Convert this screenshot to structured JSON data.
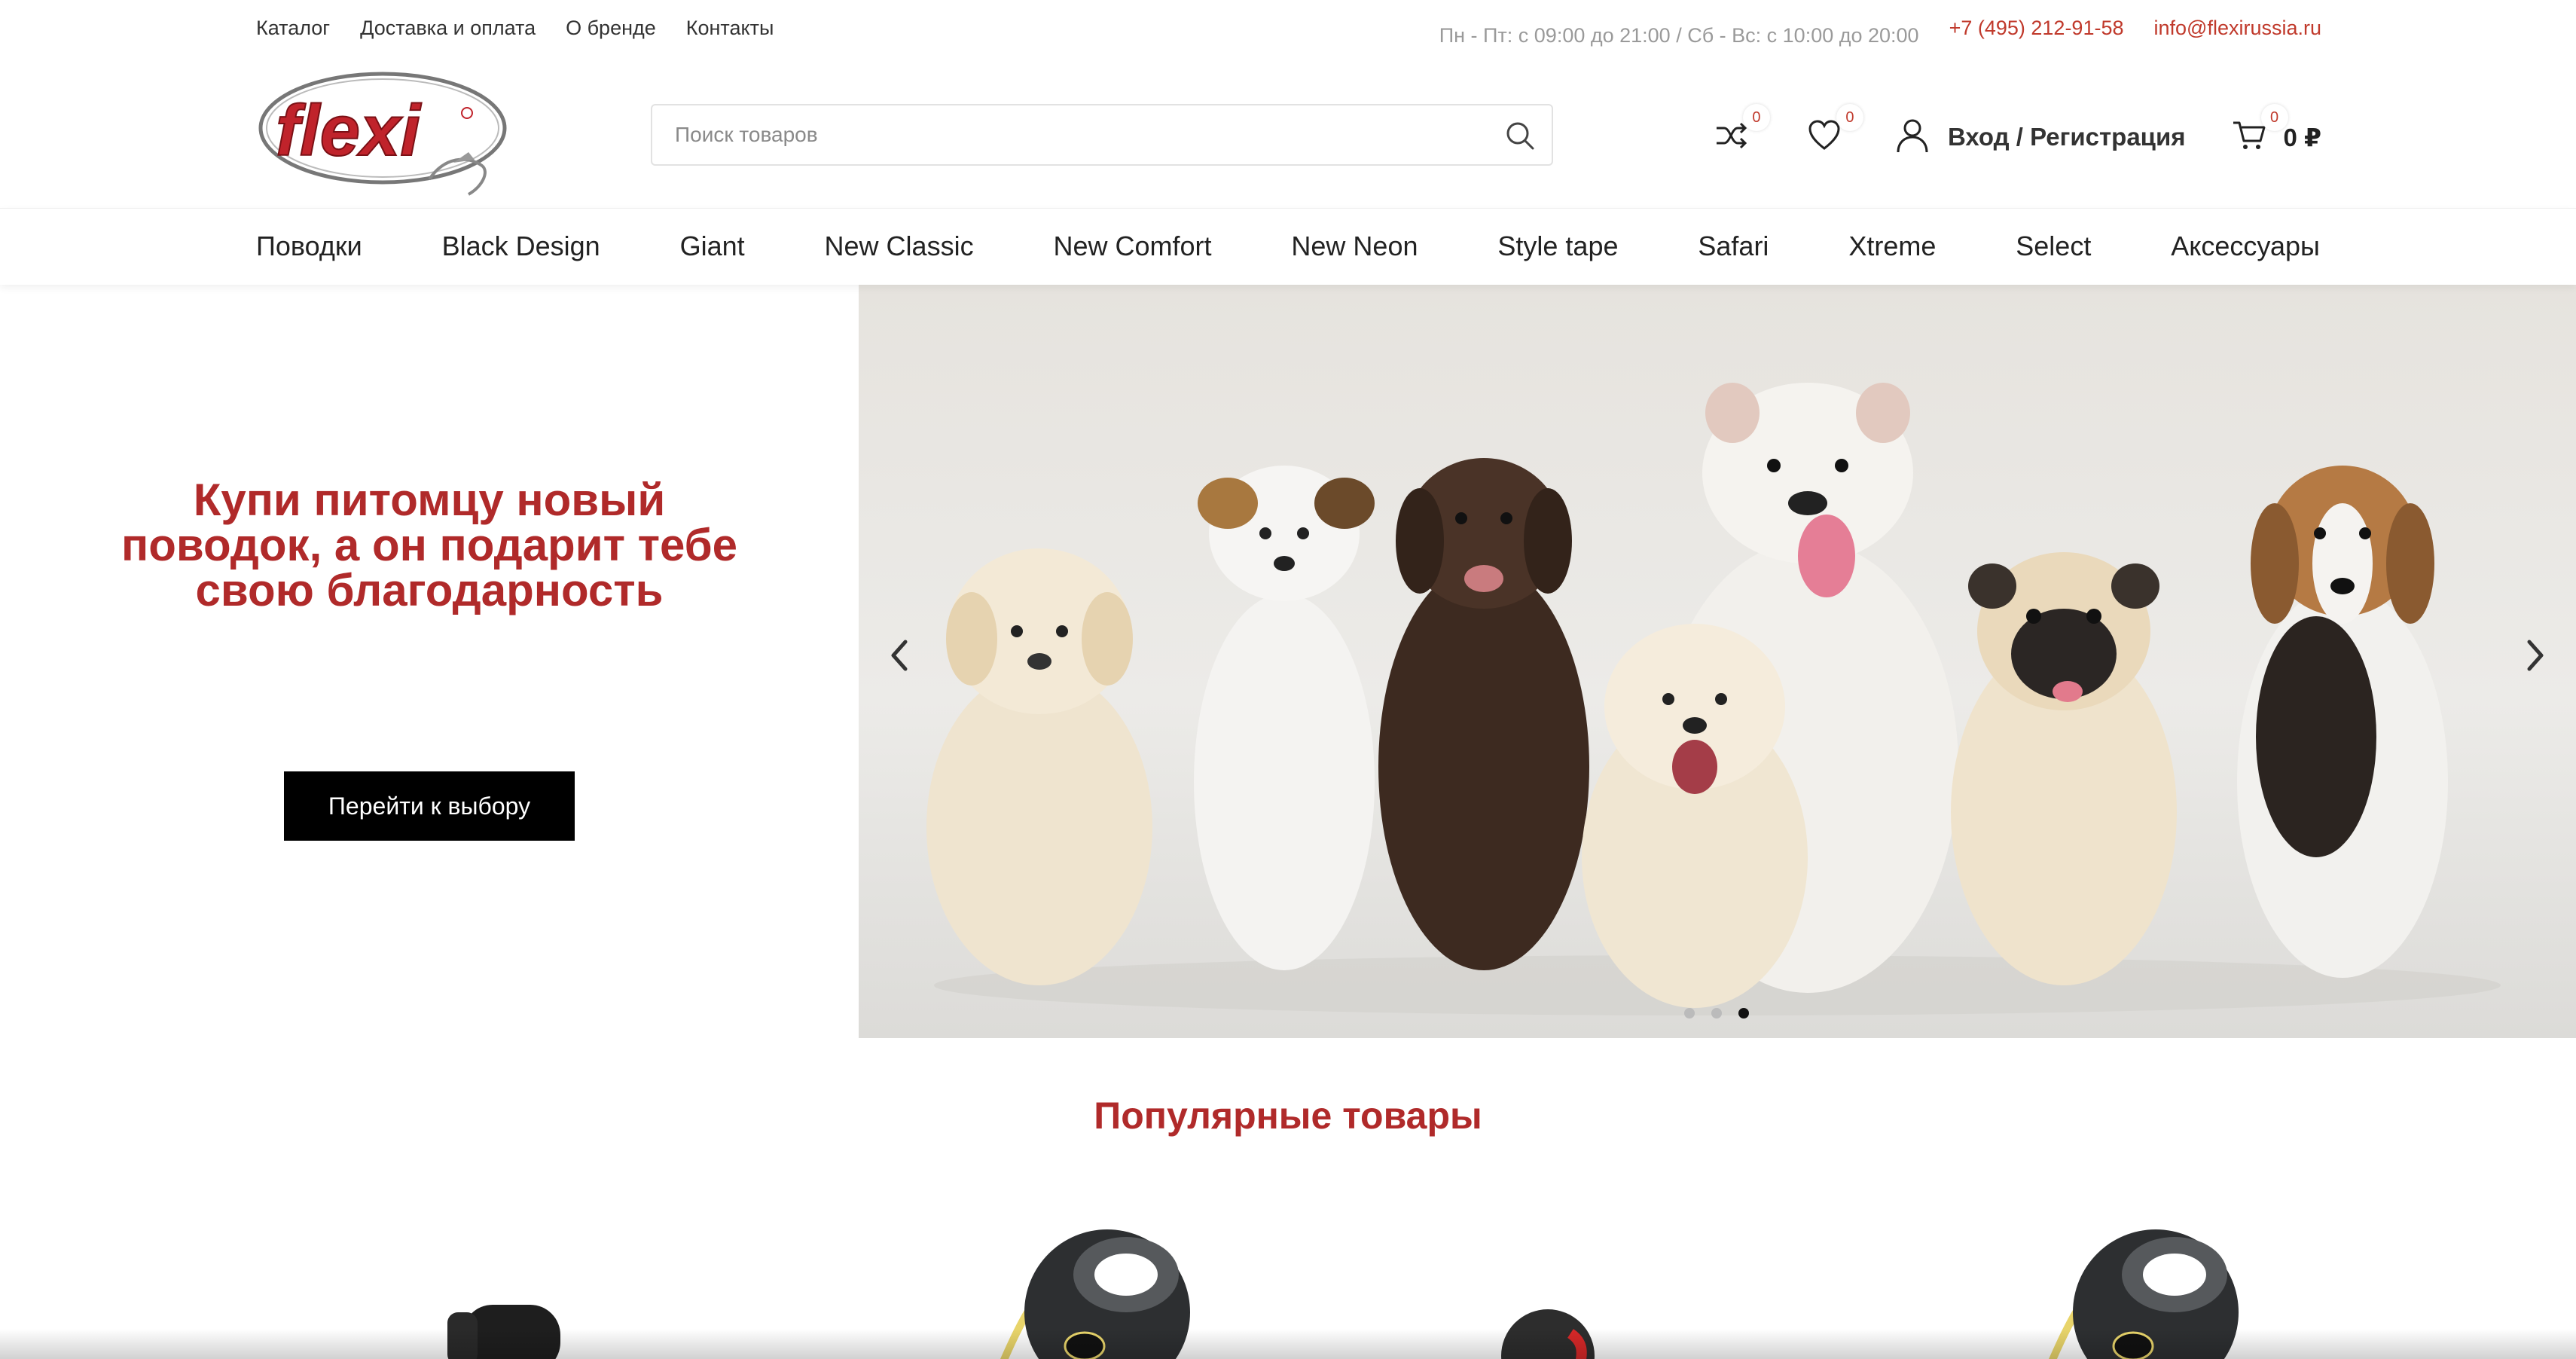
{
  "topbar": {
    "links": [
      "Каталог",
      "Доставка и оплата",
      "О бренде",
      "Контакты"
    ],
    "hours": "Пн - Пт: с 09:00 до 21:00 / Сб - Вс: с 10:00 до 20:00",
    "phone": "+7 (495) 212-91-58",
    "email": "info@flexirussia.ru"
  },
  "header": {
    "logo_text": "flexi",
    "search_placeholder": "Поиск товаров",
    "compare_count": "0",
    "wishlist_count": "0",
    "login_label": "Вход / Регистрация",
    "cart_count": "0",
    "cart_total": "0 ₽"
  },
  "nav": {
    "items": [
      "Поводки",
      "Black Design",
      "Giant",
      "New Classic",
      "New Comfort",
      "New Neon",
      "Style tape",
      "Safari",
      "Xtreme",
      "Select",
      "Аксессуары"
    ]
  },
  "hero": {
    "title": "Купи питомцу новый поводок, а он подарит тебе свою благодарность",
    "button_label": "Перейти к выбору",
    "slide_count": 3,
    "active_slide": 3
  },
  "popular": {
    "title": "Популярные товары"
  },
  "colors": {
    "accent": "#b02a2a",
    "link_red": "#c0392b",
    "button_bg": "#000000"
  }
}
